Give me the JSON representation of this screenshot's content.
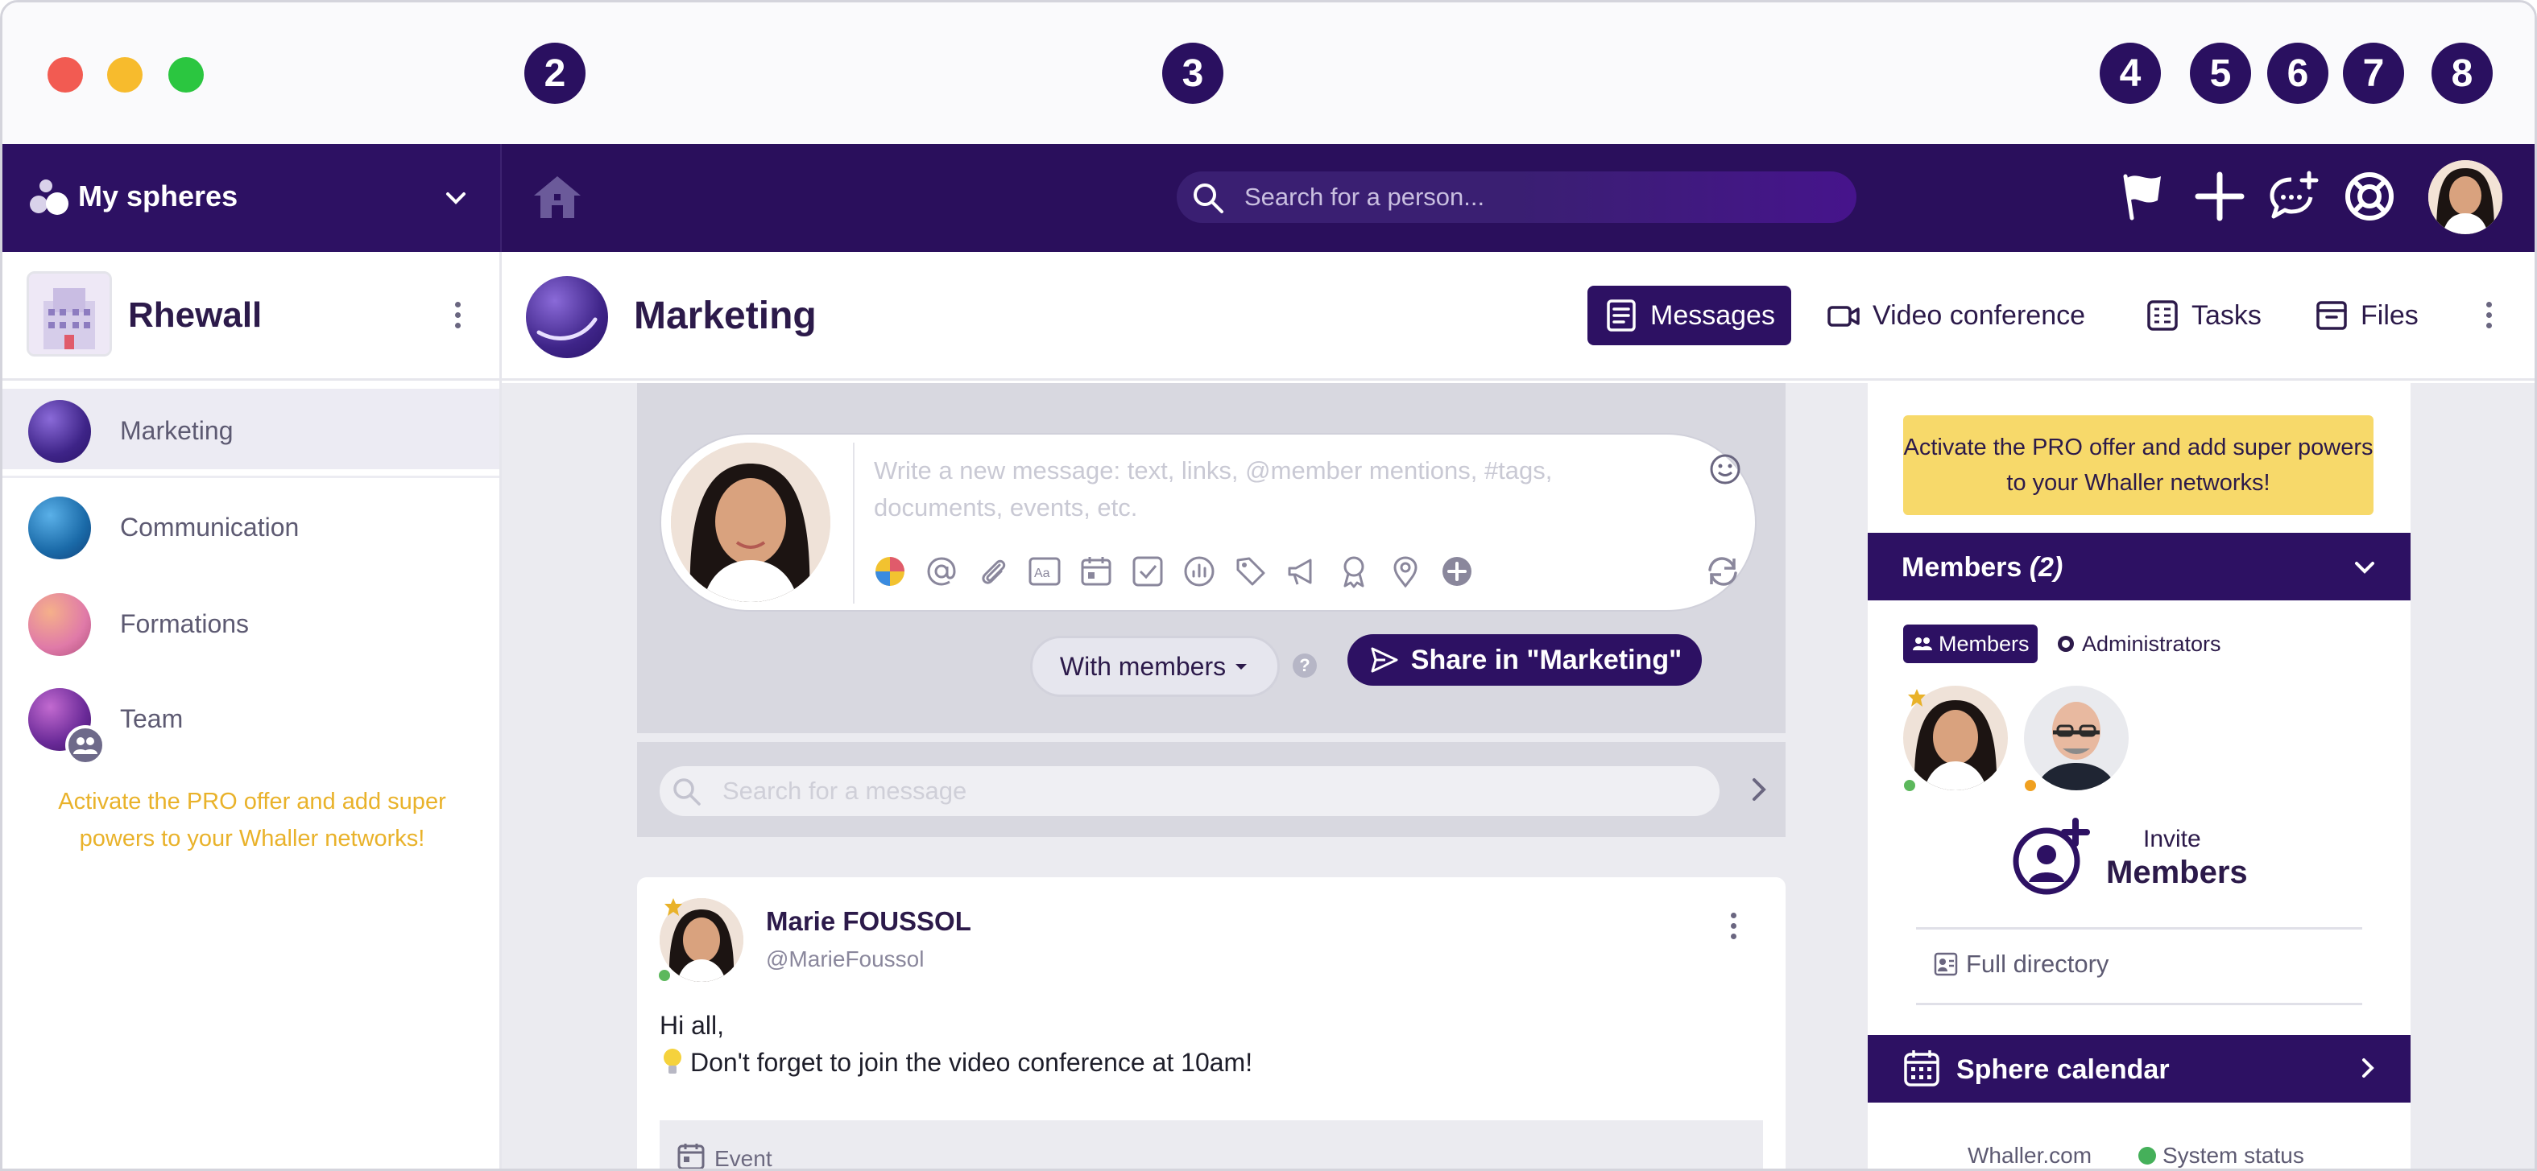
{
  "titlebar": {
    "markers": [
      "2",
      "3",
      "4",
      "5",
      "6",
      "7",
      "8"
    ]
  },
  "topnav": {
    "spheres_label": "My spheres",
    "search_placeholder": "Search for a person..."
  },
  "network": {
    "name": "Rhewall"
  },
  "sidebar": {
    "spheres": [
      {
        "label": "Marketing"
      },
      {
        "label": "Communication"
      },
      {
        "label": "Formations"
      },
      {
        "label": "Team"
      }
    ],
    "promo": "Activate the PRO offer and add super powers to your Whaller networks!"
  },
  "sphere": {
    "title": "Marketing",
    "tabs": [
      {
        "label": "Messages"
      },
      {
        "label": "Video conference"
      },
      {
        "label": "Tasks"
      },
      {
        "label": "Files"
      }
    ]
  },
  "composer": {
    "placeholder": "Write a new message: text, links, @member mentions, #tags, documents, events, etc.",
    "audience": "With members",
    "share_label": "Share in \"Marketing\""
  },
  "message_search": {
    "placeholder": "Search for a message"
  },
  "post": {
    "author": "Marie FOUSSOL",
    "handle": "@MarieFoussol",
    "line1": "Hi all,",
    "line2": "Don't forget to join the video conference at 10am!",
    "attachment_label": "Event"
  },
  "right_panel": {
    "promo": "Activate the PRO offer and add super powers to your Whaller networks!",
    "members_title": "Members",
    "members_count": "(2)",
    "chip_members": "Members",
    "chip_admins": "Administrators",
    "invite_line1": "Invite",
    "invite_line2": "Members",
    "full_directory": "Full directory",
    "calendar_title": "Sphere calendar",
    "footer_link": "Whaller.com",
    "footer_status": "System status"
  },
  "colors": {
    "brand": "#2d1163",
    "promo_yellow": "#f7d96a",
    "online": "#5cb85c"
  }
}
